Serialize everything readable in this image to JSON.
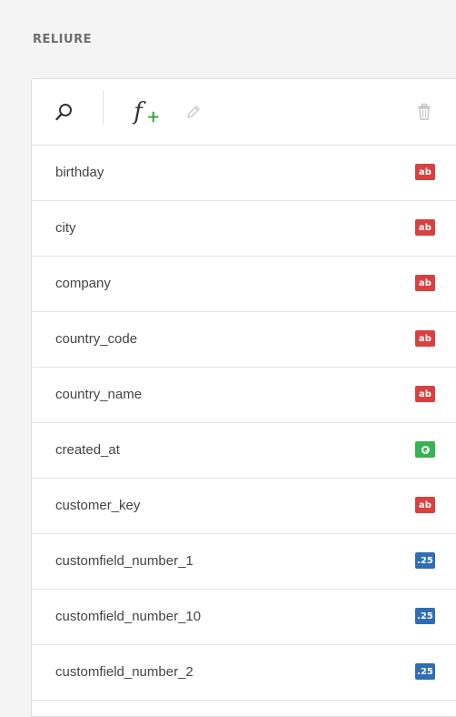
{
  "section": {
    "title": "RELIURE"
  },
  "toolbar": {
    "search_icon": "search-icon",
    "add_formula_icon": "function-add-icon",
    "edit_icon": "pencil-icon",
    "delete_icon": "trash-icon"
  },
  "colors": {
    "text_type": "#d8413f",
    "date_type": "#35b350",
    "number_type": "#2f6db5"
  },
  "fields": [
    {
      "name": "birthday",
      "type": "text",
      "badge": "ab"
    },
    {
      "name": "city",
      "type": "text",
      "badge": "ab"
    },
    {
      "name": "company",
      "type": "text",
      "badge": "ab"
    },
    {
      "name": "country_code",
      "type": "text",
      "badge": "ab"
    },
    {
      "name": "country_name",
      "type": "text",
      "badge": "ab"
    },
    {
      "name": "created_at",
      "type": "date",
      "badge": "clock"
    },
    {
      "name": "customer_key",
      "type": "text",
      "badge": "ab"
    },
    {
      "name": "customfield_number_1",
      "type": "number",
      "badge": ".25"
    },
    {
      "name": "customfield_number_10",
      "type": "number",
      "badge": ".25"
    },
    {
      "name": "customfield_number_2",
      "type": "number",
      "badge": ".25"
    }
  ]
}
